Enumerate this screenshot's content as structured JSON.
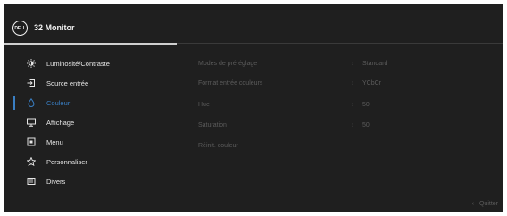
{
  "header": {
    "logo_text": "DELL",
    "title": "32 Monitor"
  },
  "menu": {
    "items": [
      {
        "label": "Luminosité/Contraste",
        "icon": "brightness-icon"
      },
      {
        "label": "Source entrée",
        "icon": "input-source-icon"
      },
      {
        "label": "Couleur",
        "icon": "color-icon",
        "active": true
      },
      {
        "label": "Affichage",
        "icon": "display-icon"
      },
      {
        "label": "Menu",
        "icon": "menu-icon"
      },
      {
        "label": "Personnaliser",
        "icon": "star-icon"
      },
      {
        "label": "Divers",
        "icon": "others-icon"
      }
    ]
  },
  "options": [
    {
      "label": "Modes de préréglage",
      "value": "Standard"
    },
    {
      "label": "Format entrée couleurs",
      "value": "YCbCr"
    },
    {
      "label": "Hue",
      "value": "50"
    },
    {
      "label": "Saturation",
      "value": "50"
    },
    {
      "label": "Réinit. couleur",
      "value": ""
    }
  ],
  "footer": {
    "exit_label": "Quitter"
  },
  "colors": {
    "accent": "#3a7fc4",
    "background": "#1f1f1f",
    "disabled_text": "#5c5c5c"
  }
}
